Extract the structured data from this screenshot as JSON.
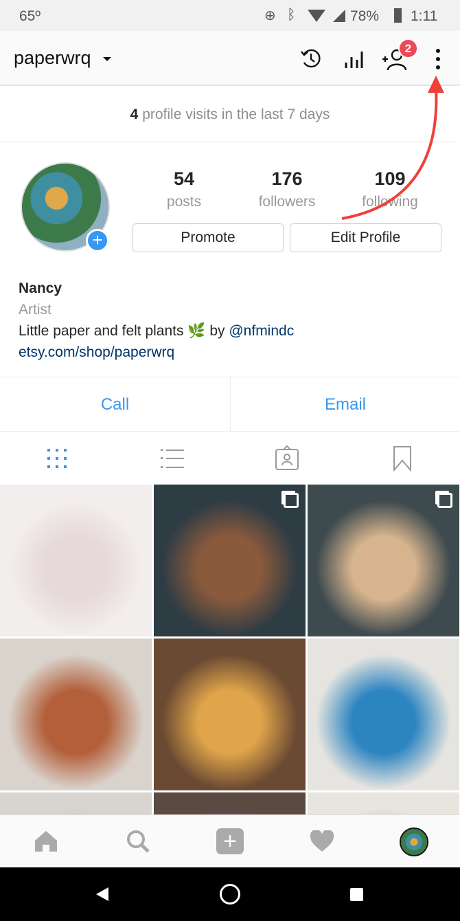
{
  "status_bar": {
    "temperature": "65º",
    "battery": "78%",
    "time": "1:11"
  },
  "header": {
    "username": "paperwrq",
    "notification_badge": "2",
    "icons": [
      "history-icon",
      "insights-icon",
      "discover-people-icon",
      "more-options-icon"
    ]
  },
  "visits": {
    "count": "4",
    "text": "profile visits in the last 7 days"
  },
  "stats": [
    {
      "value": "54",
      "label": "posts"
    },
    {
      "value": "176",
      "label": "followers"
    },
    {
      "value": "109",
      "label": "following"
    }
  ],
  "buttons": {
    "promote": "Promote",
    "edit_profile": "Edit Profile"
  },
  "bio": {
    "name": "Nancy",
    "category": "Artist",
    "text_before": "Little paper and felt plants ",
    "emoji": "🌿",
    "text_by": " by ",
    "mention": "@nfmindc",
    "link": "etsy.com/shop/paperwrq"
  },
  "contact": {
    "call": "Call",
    "email": "Email"
  },
  "tabs": [
    "grid-icon",
    "list-icon",
    "tagged-icon",
    "saved-icon"
  ],
  "accent": "#3897f0",
  "annotation_color": "#f0403a",
  "posts": [
    {
      "colors": [
        "#f3eeee",
        "#e7d9da"
      ],
      "multi": false
    },
    {
      "colors": [
        "#2e3c44",
        "#8a5a3c"
      ],
      "multi": true
    },
    {
      "colors": [
        "#3d4a4e",
        "#d7b48e"
      ],
      "multi": true
    },
    {
      "colors": [
        "#d9d3cc",
        "#b35f3a"
      ],
      "multi": false
    },
    {
      "colors": [
        "#6b4a33",
        "#e0a54a"
      ],
      "multi": false
    },
    {
      "colors": [
        "#e6e4e0",
        "#2d85c0"
      ],
      "multi": false
    },
    {
      "colors": [
        "#d8d5d0",
        "#bbb"
      ],
      "multi": false
    },
    {
      "colors": [
        "#5a4a42",
        "#a54a7a"
      ],
      "multi": false
    },
    {
      "colors": [
        "#e8e4de",
        "#9bb5b2"
      ],
      "multi": false
    }
  ]
}
